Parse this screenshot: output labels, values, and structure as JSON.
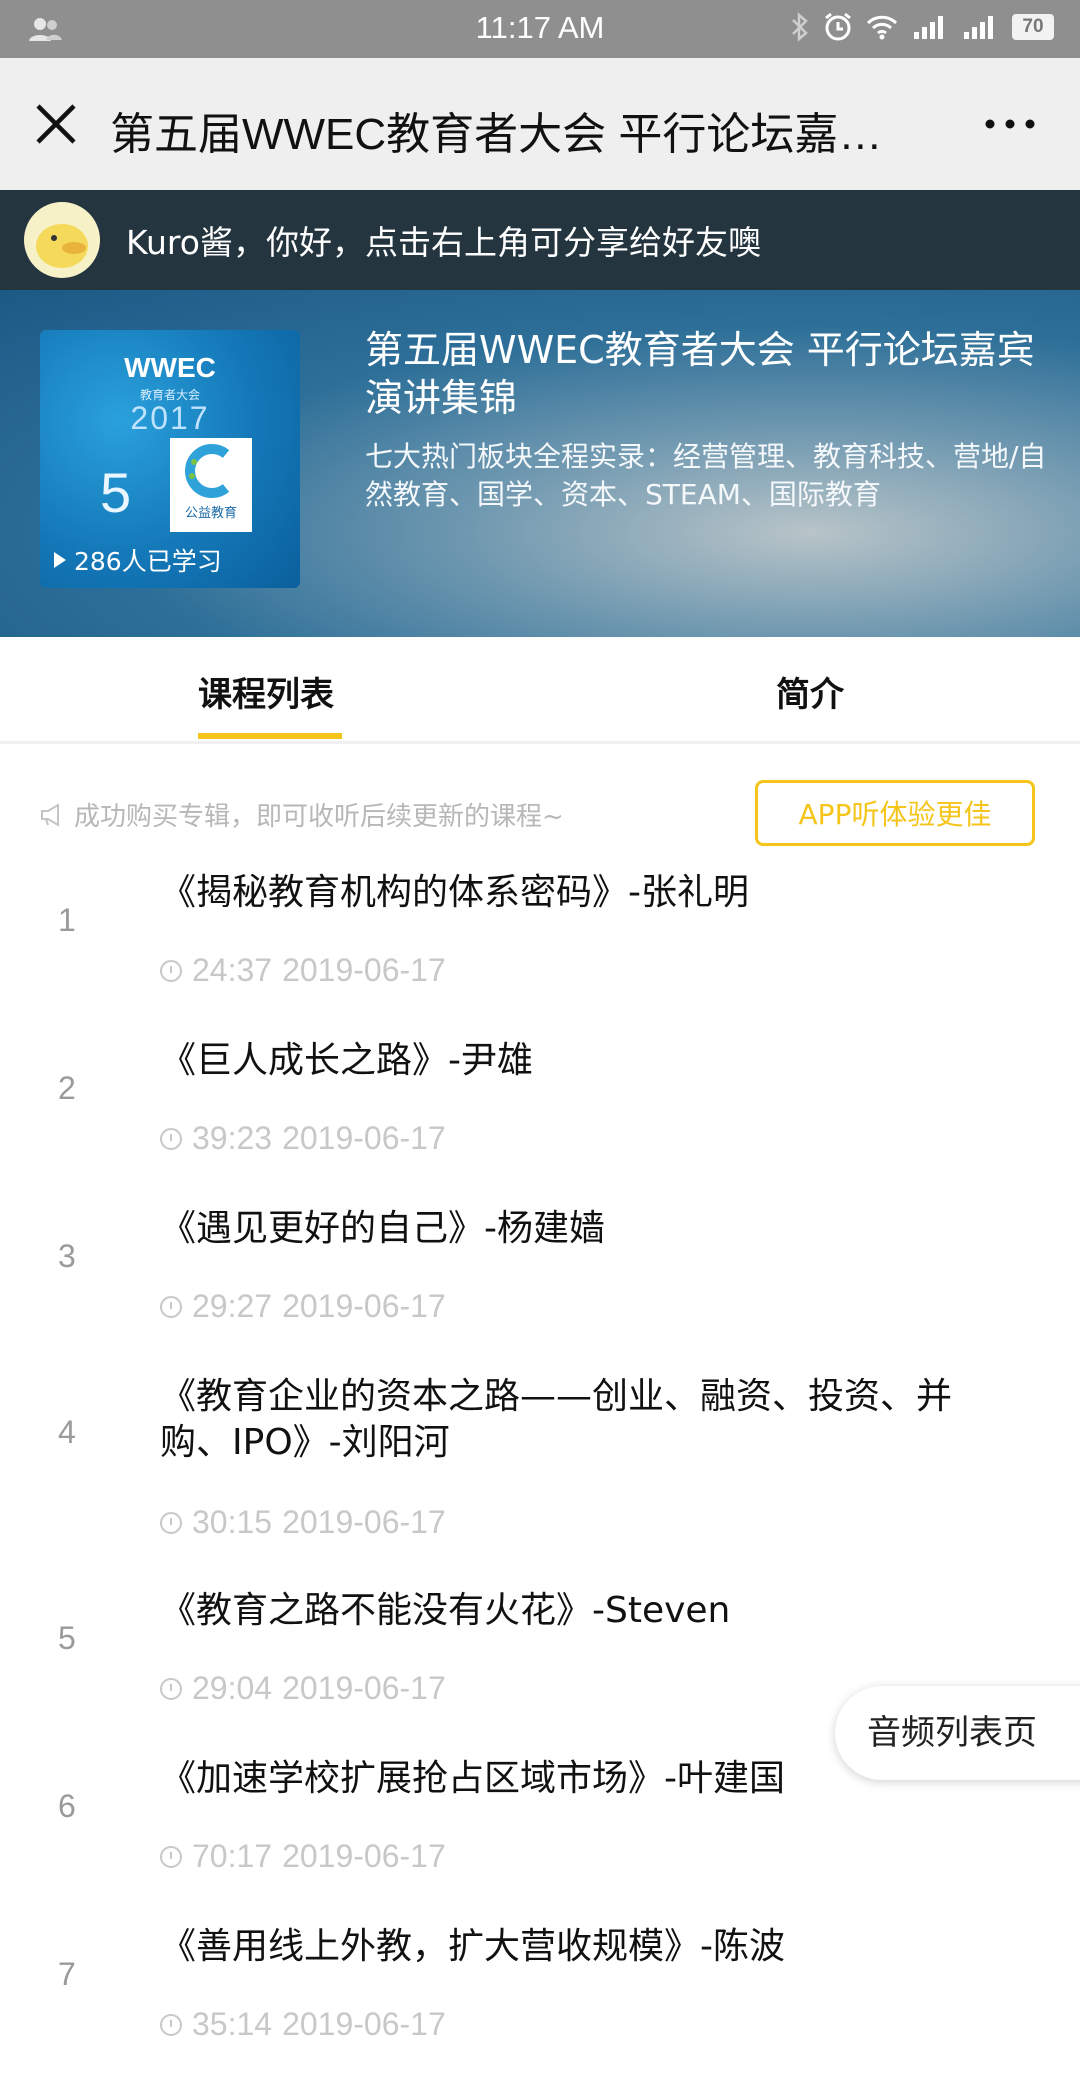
{
  "status_bar": {
    "time": "11:17 AM",
    "battery": "70",
    "icons": [
      "user-icon",
      "bluetooth-icon",
      "alarm-icon",
      "wifi-icon",
      "signal-icon",
      "signal-2-icon",
      "battery-icon"
    ]
  },
  "header": {
    "title": "第五届WWEC教育者大会 平行论坛嘉…",
    "close_icon": "close-icon",
    "more_icon": "more-icon"
  },
  "greeting": {
    "text": "Kuro酱，你好，点击右上角可分享给好友噢"
  },
  "hero": {
    "title": "第五届WWEC教育者大会 平行论坛嘉宾演讲集锦",
    "description": "七大热门板块全程实录：经营管理、教育科技、营地/自然教育、国学、资本、STEAM、国际教育",
    "cover": {
      "logo": "WWEC",
      "logo_sub": "教育者大会",
      "year": "2017",
      "five": "5",
      "badge_text": "公益教育",
      "learners": "286人已学习"
    }
  },
  "tabs": {
    "courses": "课程列表",
    "intro": "简介",
    "active": "courses",
    "accent": "#f6c51b"
  },
  "notice": {
    "text": "成功购买专辑，即可收听后续更新的课程~",
    "app_button": "APP听体验更佳"
  },
  "courses": [
    {
      "num": "1",
      "title": "《揭秘教育机构的体系密码》-张礼明",
      "duration": "24:37",
      "date": "2019-06-17"
    },
    {
      "num": "2",
      "title": "《巨人成长之路》-尹雄",
      "duration": "39:23",
      "date": "2019-06-17"
    },
    {
      "num": "3",
      "title": "《遇见更好的自己》-杨建嫱",
      "duration": "29:27",
      "date": "2019-06-17"
    },
    {
      "num": "4",
      "title": "《教育企业的资本之路——创业、融资、投资、并购、IPO》-刘阳河",
      "duration": "30:15",
      "date": "2019-06-17"
    },
    {
      "num": "5",
      "title": "《教育之路不能没有火花》-Steven",
      "duration": "29:04",
      "date": "2019-06-17"
    },
    {
      "num": "6",
      "title": "《加速学校扩展抢占区域市场》-叶建国",
      "duration": "70:17",
      "date": "2019-06-17"
    },
    {
      "num": "7",
      "title": "《善用线上外教，扩大营收规模》-陈波",
      "duration": "35:14",
      "date": "2019-06-17"
    }
  ],
  "float_button": "音频列表页"
}
